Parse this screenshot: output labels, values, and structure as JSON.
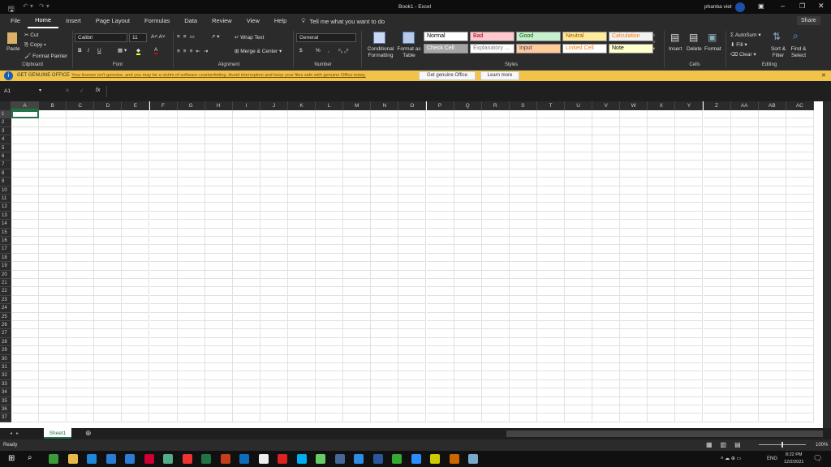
{
  "title": "Book1  -  Excel",
  "user": "phanba viet",
  "tabs": [
    "File",
    "Home",
    "Insert",
    "Page Layout",
    "Formulas",
    "Data",
    "Review",
    "View",
    "Help"
  ],
  "tell_me": "Tell me what you want to do",
  "share": "Share",
  "clipboard": {
    "paste": "Paste",
    "cut": "Cut",
    "copy": "Copy",
    "format_painter": "Format Painter",
    "label": "Clipboard"
  },
  "font": {
    "name": "Calibri",
    "size": "11",
    "bold": "B",
    "italic": "I",
    "underline": "U",
    "label": "Font"
  },
  "alignment": {
    "wrap": "Wrap Text",
    "merge": "Merge & Center",
    "label": "Alignment"
  },
  "number": {
    "format": "General",
    "currency": "$",
    "percent": "%",
    "comma": ",",
    "label": "Number"
  },
  "styles": {
    "conditional": "Conditional Formatting",
    "format_table": "Format as Table",
    "label": "Styles",
    "items": [
      {
        "name": "Normal",
        "bg": "#ffffff",
        "fg": "#000000"
      },
      {
        "name": "Bad",
        "bg": "#ffc7ce",
        "fg": "#9c0006"
      },
      {
        "name": "Good",
        "bg": "#c6efce",
        "fg": "#006100"
      },
      {
        "name": "Neutral",
        "bg": "#ffeb9c",
        "fg": "#9c5700"
      },
      {
        "name": "Calculation",
        "bg": "#f2f2f2",
        "fg": "#fa7d00"
      },
      {
        "name": "Check Cell",
        "bg": "#a5a5a5",
        "fg": "#ffffff"
      },
      {
        "name": "Explanatory ...",
        "bg": "#ffffff",
        "fg": "#7f7f7f"
      },
      {
        "name": "Input",
        "bg": "#ffcc99",
        "fg": "#3f3f76"
      },
      {
        "name": "Linked Cell",
        "bg": "#ffffff",
        "fg": "#fa7d00"
      },
      {
        "name": "Note",
        "bg": "#ffffcc",
        "fg": "#000000"
      }
    ]
  },
  "cells": {
    "insert": "Insert",
    "delete": "Delete",
    "format": "Format",
    "label": "Cells"
  },
  "editing": {
    "autosum": "AutoSum",
    "fill": "Fill",
    "clear": "Clear",
    "sort": "Sort & Filter",
    "find": "Find & Select",
    "label": "Editing"
  },
  "banner": {
    "title": "GET GENUINE OFFICE",
    "message": "Your license isn't genuine, and you may be a victim of software counterfeiting. Avoid interruption and keep your files safe with genuine Office today.",
    "btn1": "Get genuine Office",
    "btn2": "Learn more"
  },
  "name_box": "A1",
  "fx": "fx",
  "columns": [
    "A",
    "B",
    "C",
    "D",
    "E",
    "F",
    "G",
    "H",
    "I",
    "J",
    "K",
    "L",
    "M",
    "N",
    "O",
    "P",
    "Q",
    "R",
    "S",
    "T",
    "U",
    "V",
    "W",
    "X",
    "Y",
    "Z",
    "AA",
    "AB",
    "AC"
  ],
  "rows": [
    1,
    2,
    3,
    4,
    5,
    6,
    7,
    8,
    9,
    10,
    11,
    12,
    13,
    14,
    15,
    16,
    17,
    18,
    19,
    20,
    21,
    22,
    23,
    24,
    25,
    26,
    27,
    28,
    29,
    30,
    31,
    32,
    33,
    34,
    35,
    36,
    37
  ],
  "sheet": "Sheet1",
  "status": "Ready",
  "zoom": "100%",
  "tray": {
    "lang": "ENG",
    "time": "8:22 PM",
    "date": "12/2/2021"
  }
}
